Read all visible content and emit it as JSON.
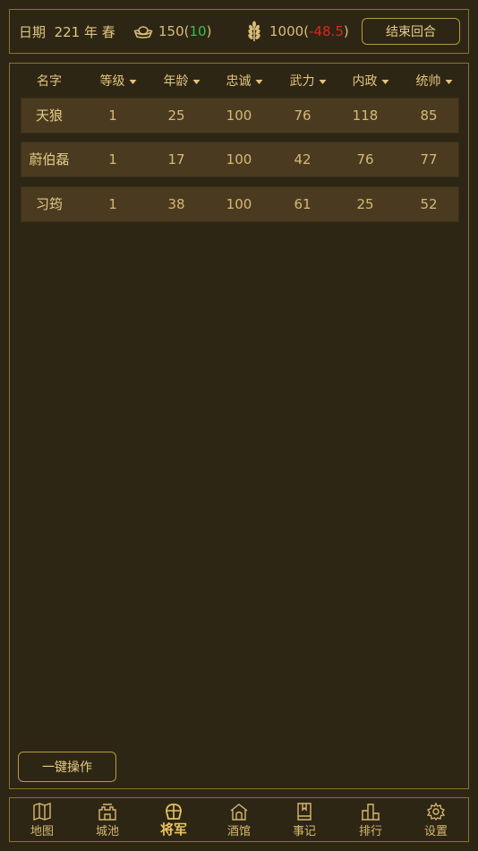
{
  "header": {
    "date_label": "日期",
    "date_value": "221 年 春",
    "gold": "150",
    "gold_delta": "10",
    "grain": "1000",
    "grain_delta": "-48.5",
    "end_turn_label": "结束回合"
  },
  "table": {
    "columns": [
      "名字",
      "等级",
      "年龄",
      "忠诚",
      "武力",
      "内政",
      "统帅"
    ],
    "rows": [
      [
        "天狼",
        "1",
        "25",
        "100",
        "76",
        "118",
        "85"
      ],
      [
        "蔚伯磊",
        "1",
        "17",
        "100",
        "42",
        "76",
        "77"
      ],
      [
        "习筠",
        "1",
        "38",
        "100",
        "61",
        "25",
        "52"
      ]
    ]
  },
  "bulk_action_label": "一键操作",
  "nav": {
    "items": [
      {
        "label": "地图",
        "icon": "map-icon"
      },
      {
        "label": "城池",
        "icon": "castle-icon"
      },
      {
        "label": "将军",
        "icon": "helmet-icon"
      },
      {
        "label": "酒馆",
        "icon": "tavern-icon"
      },
      {
        "label": "事记",
        "icon": "book-icon"
      },
      {
        "label": "排行",
        "icon": "ranking-icon"
      },
      {
        "label": "设置",
        "icon": "gear-icon"
      }
    ],
    "active": "将军"
  },
  "colors": {
    "background": "#2e2615",
    "accent": "#d8bc77",
    "positive": "#33c24c",
    "negative": "#d8261f",
    "row_bg": "#4a3b20"
  }
}
